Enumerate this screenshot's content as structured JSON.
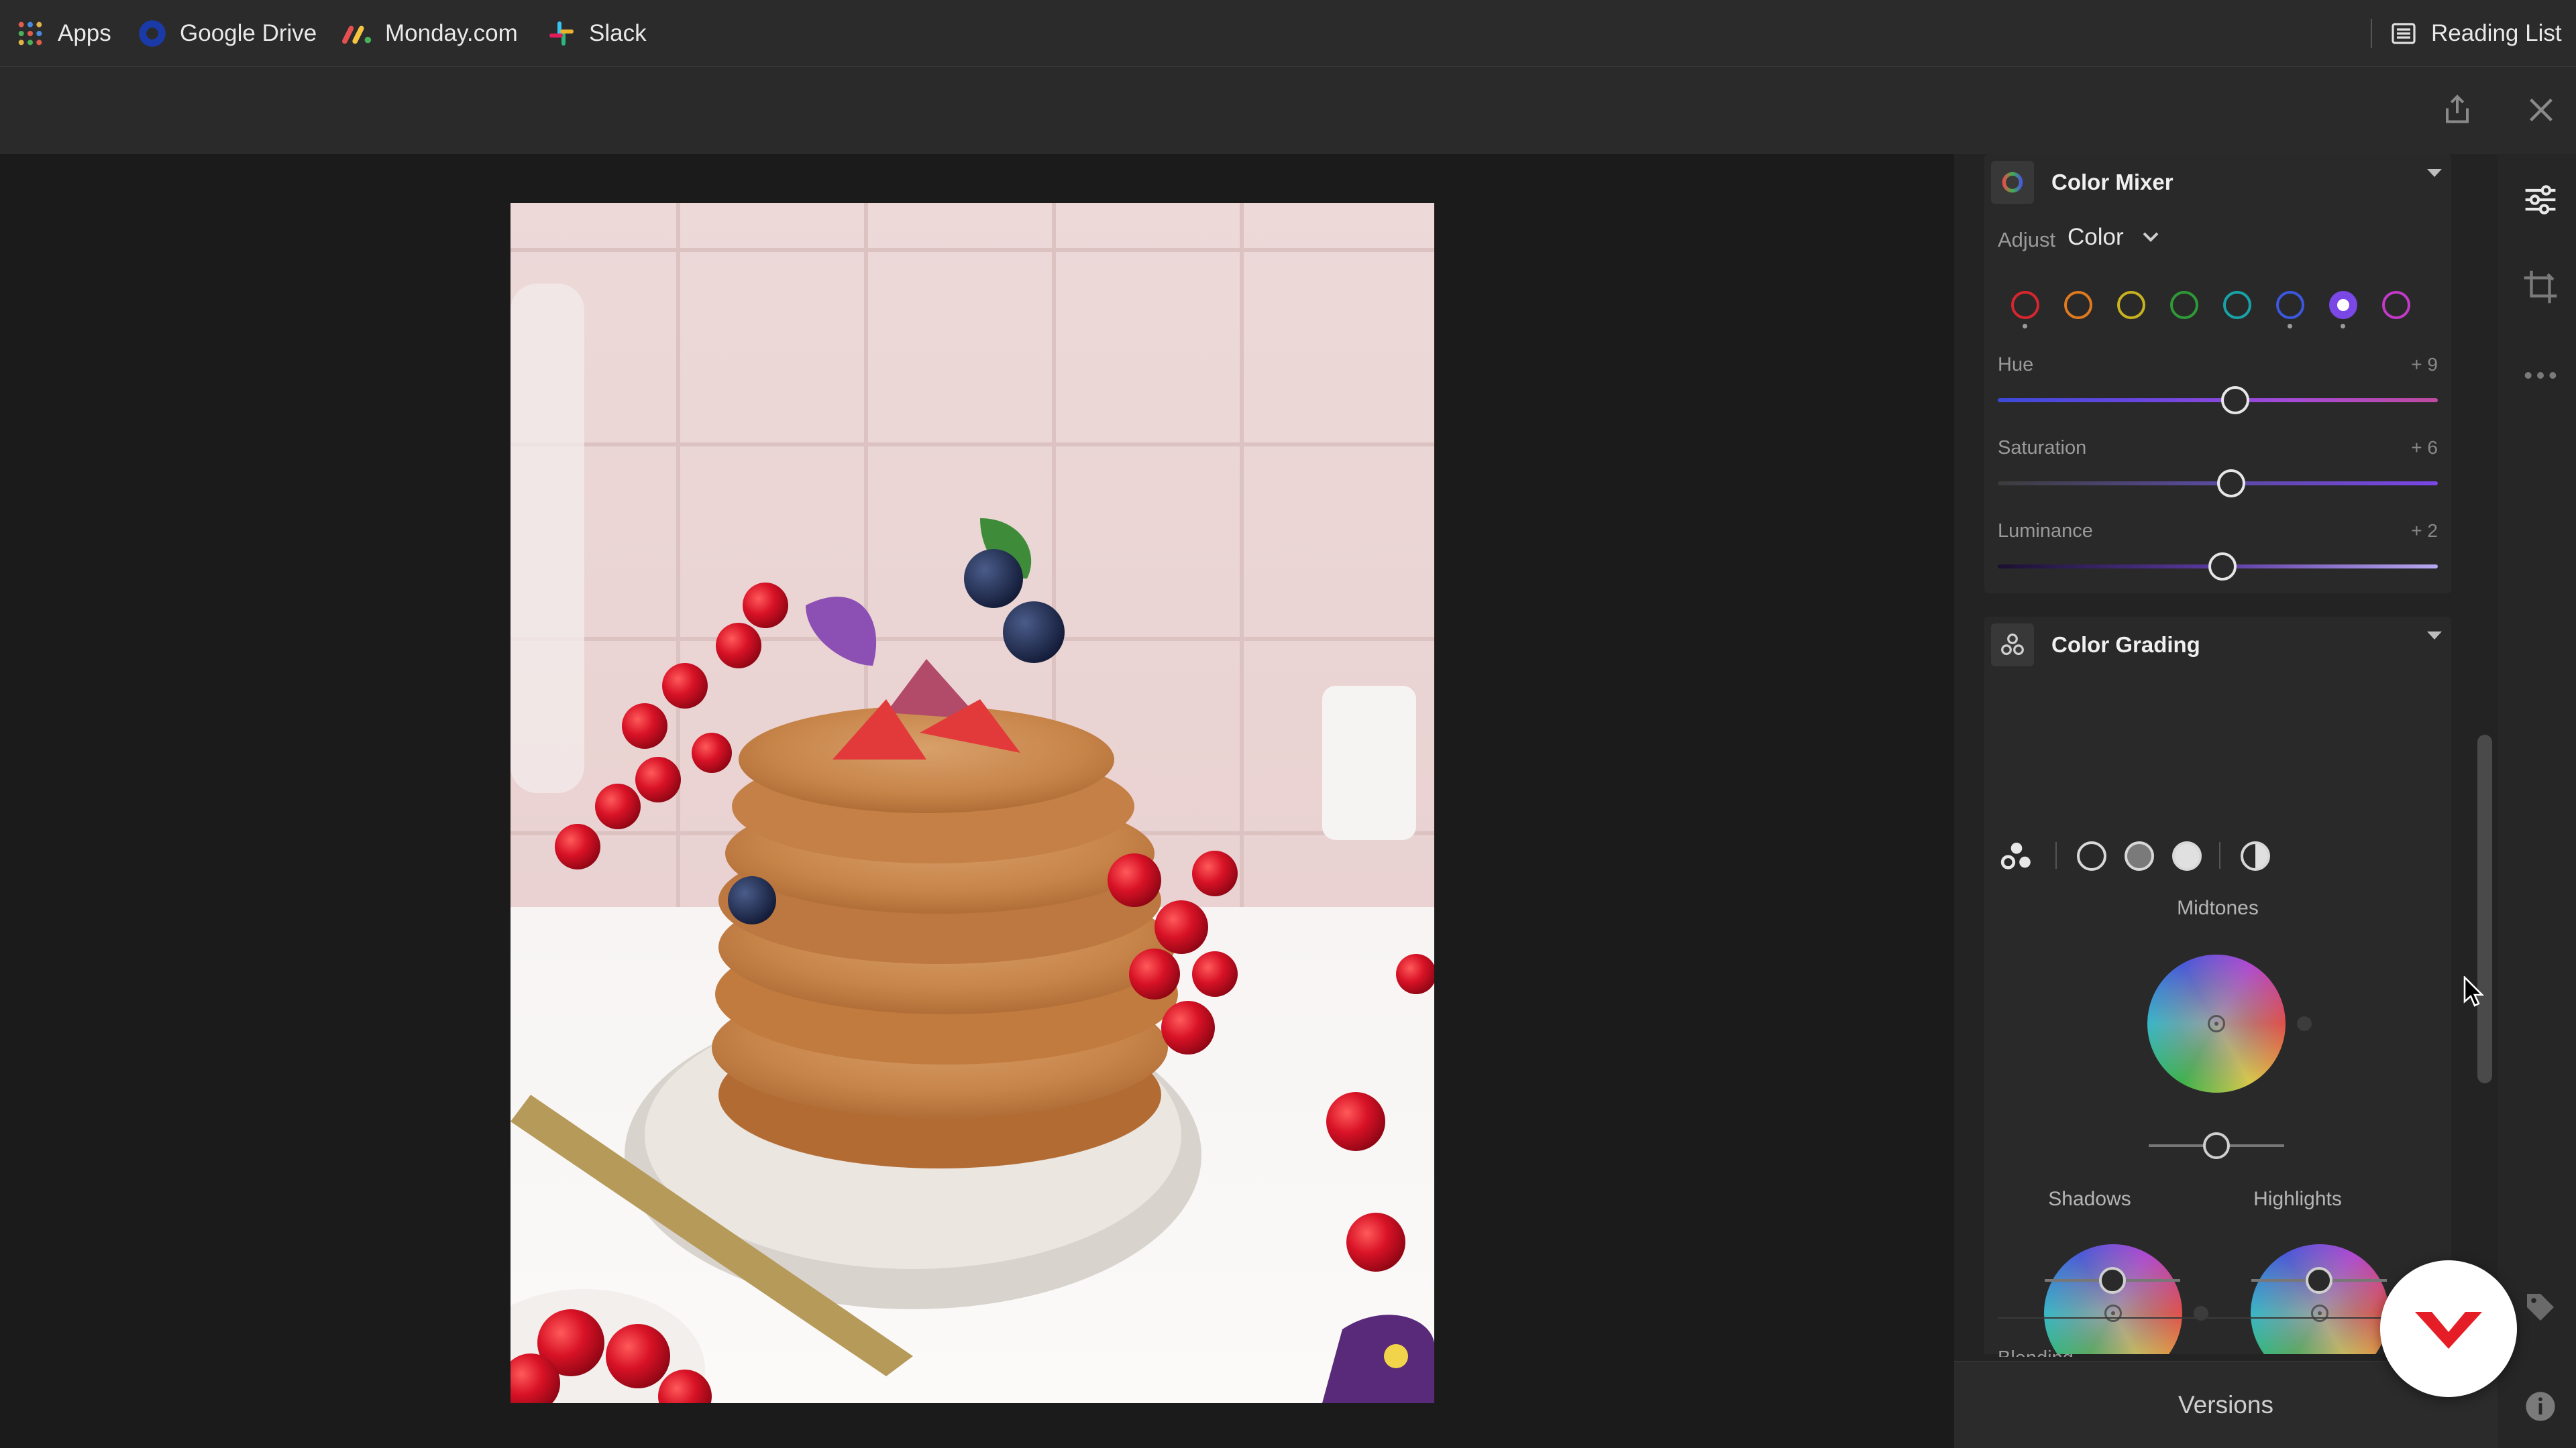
{
  "bookmarks": {
    "items": [
      {
        "label": "Apps",
        "icon": "apps-grid-icon"
      },
      {
        "label": "Google Drive",
        "icon": "google-drive-icon"
      },
      {
        "label": "Monday.com",
        "icon": "monday-icon"
      },
      {
        "label": "Slack",
        "icon": "slack-icon"
      }
    ],
    "reading_list": "Reading List"
  },
  "toolbar": {
    "share_icon": "share-icon",
    "close_icon": "close-icon"
  },
  "color_mixer": {
    "title": "Color Mixer",
    "adjust_label": "Adjust",
    "adjust_value": "Color",
    "swatches": [
      {
        "name": "red",
        "color": "#d8262f"
      },
      {
        "name": "orange",
        "color": "#e07a1f"
      },
      {
        "name": "yellow",
        "color": "#c8b21e"
      },
      {
        "name": "green",
        "color": "#2e9a37"
      },
      {
        "name": "aqua",
        "color": "#18a3a8"
      },
      {
        "name": "blue",
        "color": "#3b58e0"
      },
      {
        "name": "purple",
        "color": "#7a46e6"
      },
      {
        "name": "magenta",
        "color": "#c23ac8"
      }
    ],
    "selected_swatch": "purple",
    "hue": {
      "label": "Hue",
      "value": "+ 9",
      "level": 0.54
    },
    "saturation": {
      "label": "Saturation",
      "value": "+ 6",
      "level": 0.53
    },
    "luminance": {
      "label": "Luminance",
      "value": "+ 2",
      "level": 0.51
    }
  },
  "color_grading": {
    "title": "Color Grading",
    "midtones": "Midtones",
    "shadows": "Shadows",
    "highlights": "Highlights",
    "blending": "Blending"
  },
  "versions": "Versions",
  "colors": {
    "accent": "#7a46e6",
    "panel": "#292929",
    "brand": "#e51d27"
  }
}
